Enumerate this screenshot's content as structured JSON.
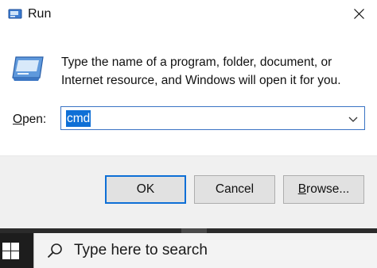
{
  "window": {
    "title": "Run",
    "icon": "run-icon",
    "close_icon": "close-icon"
  },
  "content": {
    "description": "Type the name of a program, folder, document, or Internet resource, and Windows will open it for you.",
    "open_label": "Open:",
    "open_label_mnemonic": "O",
    "open_label_rest": "pen:",
    "input_value": "cmd",
    "dropdown_icon": "chevron-down-icon"
  },
  "buttons": {
    "ok": "OK",
    "cancel": "Cancel",
    "browse_mnemonic": "B",
    "browse_rest": "rowse..."
  },
  "taskbar": {
    "start_icon": "windows-logo-icon",
    "search_placeholder": "Type here to search",
    "search_icon": "search-icon"
  },
  "colors": {
    "accent": "#0e6fd6",
    "footer_bg": "#f0f0f0",
    "taskbar_bg": "#1d1d1d"
  }
}
